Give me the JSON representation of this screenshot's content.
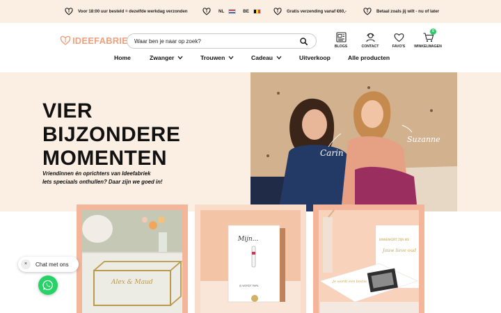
{
  "announcements": [
    {
      "text": "Voor 18:00 uur besteld = dezelfde werkdag verzonden"
    },
    {
      "nl": "NL",
      "be": "BE"
    },
    {
      "text": "Gratis verzending vanaf €60,-"
    },
    {
      "text": "Betaal zoals jij wilt - nu of later"
    }
  ],
  "header": {
    "logo_text": "IDEEFABRIEK",
    "search_placeholder": "Waar ben je naar op zoek?",
    "icons": [
      {
        "label": "BLOGS",
        "icon": "blog-icon"
      },
      {
        "label": "CONTACT",
        "icon": "contact-icon"
      },
      {
        "label": "FAVO'S",
        "icon": "heart-icon"
      },
      {
        "label": "WINKELWAGEN",
        "icon": "cart-icon",
        "badge": "0"
      }
    ]
  },
  "nav": [
    {
      "label": "Home",
      "dropdown": false
    },
    {
      "label": "Zwanger",
      "dropdown": true
    },
    {
      "label": "Trouwen",
      "dropdown": true
    },
    {
      "label": "Cadeau",
      "dropdown": true
    },
    {
      "label": "Uitverkoop",
      "dropdown": false
    },
    {
      "label": "Alle producten",
      "dropdown": false
    }
  ],
  "hero": {
    "title": "VIER BIJZONDERE MOMENTEN",
    "subtitle_line1": "Vriendinnen én oprichters van Ideefabriek",
    "subtitle_line2": "Iets speciaals onthullen? Daar zijn we goed in!",
    "photo_names": [
      "Carin",
      "Suzanne"
    ]
  },
  "cards": [
    {
      "name": "glass-jewelry-box",
      "engraving": "Alex & Maud"
    },
    {
      "name": "pregnancy-test-card",
      "script_title": "Mijn...",
      "small_text": "JIJ WORDT PAPA"
    },
    {
      "name": "reveal-box",
      "box_text_1": "BINNENKORT ZIJN WE",
      "box_text_2": "Jouw lieve oud",
      "card_text": "Je wordt een bestie..."
    }
  ],
  "chat": {
    "label": "Chat met ons",
    "close": "×"
  },
  "colors": {
    "accent": "#f0a07c",
    "hero_bg": "#fbeee2",
    "card_peach": "#f3b69b",
    "whatsapp": "#25d366"
  }
}
